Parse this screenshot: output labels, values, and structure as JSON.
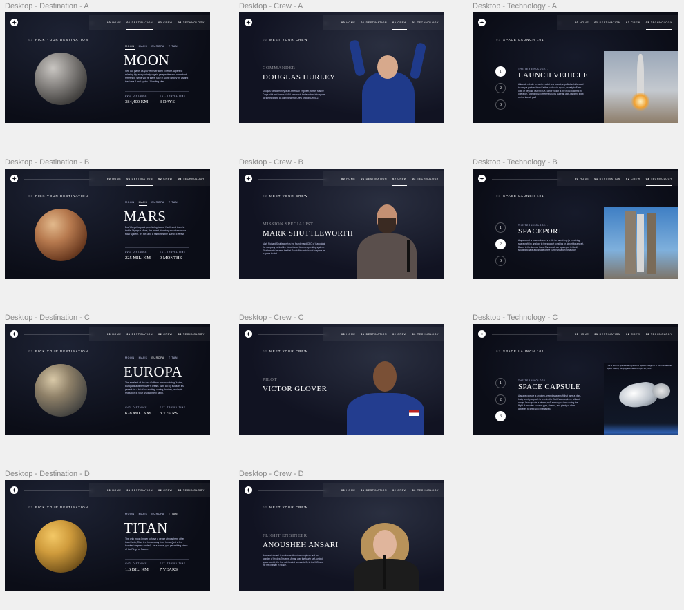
{
  "nav": {
    "home": "HOME",
    "destination": "DESTINATION",
    "crew": "CREW",
    "technology": "TECHNOLOGY",
    "n0": "00",
    "n1": "01",
    "n2": "02",
    "n3": "03"
  },
  "frames": {
    "dest_a": "Desktop - Destination - A",
    "dest_b": "Desktop - Destination - B",
    "dest_c": "Desktop - Destination - C",
    "dest_d": "Desktop - Destination - D",
    "crew_a": "Desktop - Crew - A",
    "crew_b": "Desktop - Crew -  B",
    "crew_c": "Desktop - Crew -  C",
    "crew_d": "Desktop - Crew -  D",
    "tech_a": "Desktop - Technology - A",
    "tech_b": "Desktop - Technology - B",
    "tech_c": "Desktop - Technology - C"
  },
  "destination": {
    "eyebrow_num": "01",
    "eyebrow": "PICK YOUR DESTINATION",
    "tabs": [
      "MOON",
      "MARS",
      "EUROPA",
      "TITAN"
    ],
    "distance_label": "AVG. DISTANCE",
    "travel_label": "EST. TRAVEL TIME",
    "items": [
      {
        "name": "MOON",
        "desc": "See our planet as you've never seen it before. A perfect relaxing trip away to help regain perspective and come back refreshed. While you're there, take in some history by visiting the Luna 2 and Apollo 11 landing sites.",
        "distance": "384,400 KM",
        "travel": "3 DAYS"
      },
      {
        "name": "MARS",
        "desc": "Don't forget to pack your hiking boots. You'll need them to tackle Olympus Mons, the tallest planetary mountain in our solar system. It's two and a half times the size of Everest!",
        "distance": "225 MIL. KM",
        "travel": "9 MONTHS"
      },
      {
        "name": "EUROPA",
        "desc": "The smallest of the four Galilean moons orbiting Jupiter, Europa is a winter lover's dream. With an icy surface, it's perfect for a bit of ice skating, curling, hockey, or simple relaxation in your snug wintery cabin.",
        "distance": "628 MIL. KM",
        "travel": "3 YEARS"
      },
      {
        "name": "TITAN",
        "desc": "The only moon known to have a dense atmosphere other than Earth, Titan is a home away from home (just a few hundred degrees colder!). As a bonus, you get striking views of the Rings of Saturn.",
        "distance": "1.6 BIL. KM",
        "travel": "7 YEARS"
      }
    ]
  },
  "crew": {
    "eyebrow_num": "02",
    "eyebrow": "MEET YOUR CREW",
    "items": [
      {
        "role": "COMMANDER",
        "name": "DOUGLAS HURLEY",
        "bio": "Douglas Gerald Hurley is an American engineer, former Marine Corps pilot and former NASA astronaut. He launched into space for the third time as commander of Crew Dragon Demo-2."
      },
      {
        "role": "MISSION SPECIALIST",
        "name": "MARK SHUTTLEWORTH",
        "bio": "Mark Richard Shuttleworth is the founder and CEO of Canonical, the company behind the Linux-based Ubuntu operating system. Shuttleworth became the first South African to travel to space as a space tourist."
      },
      {
        "role": "PILOT",
        "name": "VICTOR GLOVER",
        "bio": ""
      },
      {
        "role": "FLIGHT ENGINEER",
        "name": "ANOUSHEH ANSARI",
        "bio": "Anousheh Ansari is an Iranian American engineer and co-founder of Prodea Systems. Ansari was the fourth self-funded space tourist, the first self-funded woman to fly to the ISS, and the first Iranian in space."
      }
    ]
  },
  "technology": {
    "eyebrow_num": "03",
    "eyebrow": "SPACE LAUNCH 101",
    "term": "THE TERMINOLOGY...",
    "numbers": [
      "1",
      "2",
      "3"
    ],
    "items": [
      {
        "name": "LAUNCH VEHICLE",
        "desc": "A launch vehicle or carrier rocket is a rocket-propelled vehicle used to carry a payload from Earth's surface to space, usually to Earth orbit or beyond. Our WEB-X carrier rocket is the most powerful in operation. Standing 150 metres tall, it's quite an awe-inspiring sight on the launch pad!"
      },
      {
        "name": "SPACEPORT",
        "desc": "A spaceport or cosmodrome is a site for launching (or receiving) spacecraft, by analogy to the seaport for ships or airport for aircraft. Based in the famous Cape Canaveral, our spaceport is ideally situated to take advantage of the Earth's rotation for launch."
      },
      {
        "name": "SPACE CAPSULE",
        "desc": "A space capsule is an often-crewed spacecraft that uses a blunt-body reentry capsule to reenter the Earth's atmosphere without wings. Our capsule is where you'll spend your time during the flight. It includes a space gym, cinema, and plenty of other activities to keep you entertained."
      }
    ],
    "capsule_caption": "This is the first operational flight of the SpaceX Dragon 2 to the International Space Station, carrying astronauts on April 23, 2021."
  }
}
